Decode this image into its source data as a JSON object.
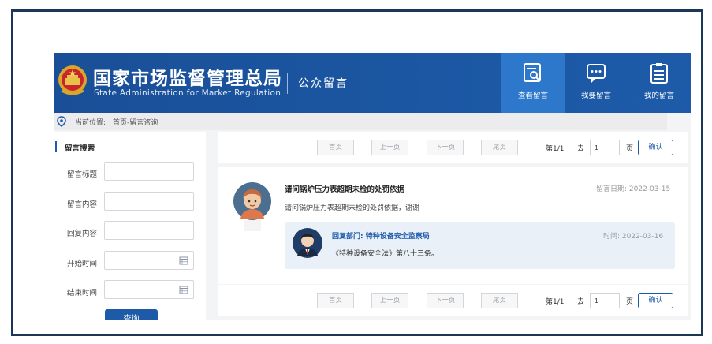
{
  "header": {
    "title_cn": "国家市场监督管理总局",
    "title_en": "State Administration for Market Regulation",
    "subtitle": "公众留言",
    "nav": [
      {
        "label": "查看留言",
        "icon": "view-message-icon",
        "active": true
      },
      {
        "label": "我要留言",
        "icon": "write-message-icon",
        "active": false
      },
      {
        "label": "我的留言",
        "icon": "my-message-icon",
        "active": false
      }
    ]
  },
  "breadcrumb": {
    "label": "当前位置:",
    "path": "首页-留言咨询"
  },
  "search_panel": {
    "title": "留言搜索",
    "fields": [
      {
        "label": "留言标题",
        "value": ""
      },
      {
        "label": "留言内容",
        "value": ""
      },
      {
        "label": "回复内容",
        "value": ""
      },
      {
        "label": "开始时间",
        "value": ""
      },
      {
        "label": "结束时间",
        "value": ""
      }
    ],
    "search_button": "查询"
  },
  "pager": {
    "first": "首页",
    "prev": "上一页",
    "next": "下一页",
    "last": "尾页",
    "page_info": "第1/1",
    "goto_label": "去",
    "page_input": "1",
    "page_unit": "页",
    "confirm": "确认"
  },
  "message": {
    "title": "请问锅炉压力表超期未检的处罚依据",
    "date": "留言日期: 2022-03-15",
    "body": "请问锅炉压力表超期未检的处罚依据，谢谢",
    "reply": {
      "dept": "回复部门: 特种设备安全监察局",
      "time": "时间: 2022-03-16",
      "text": "《特种设备安全法》第八十三条。"
    }
  },
  "colors": {
    "brand_blue": "#1b57a3",
    "active_tab": "#2d78cb",
    "reply_bg": "#eaf0f8"
  }
}
